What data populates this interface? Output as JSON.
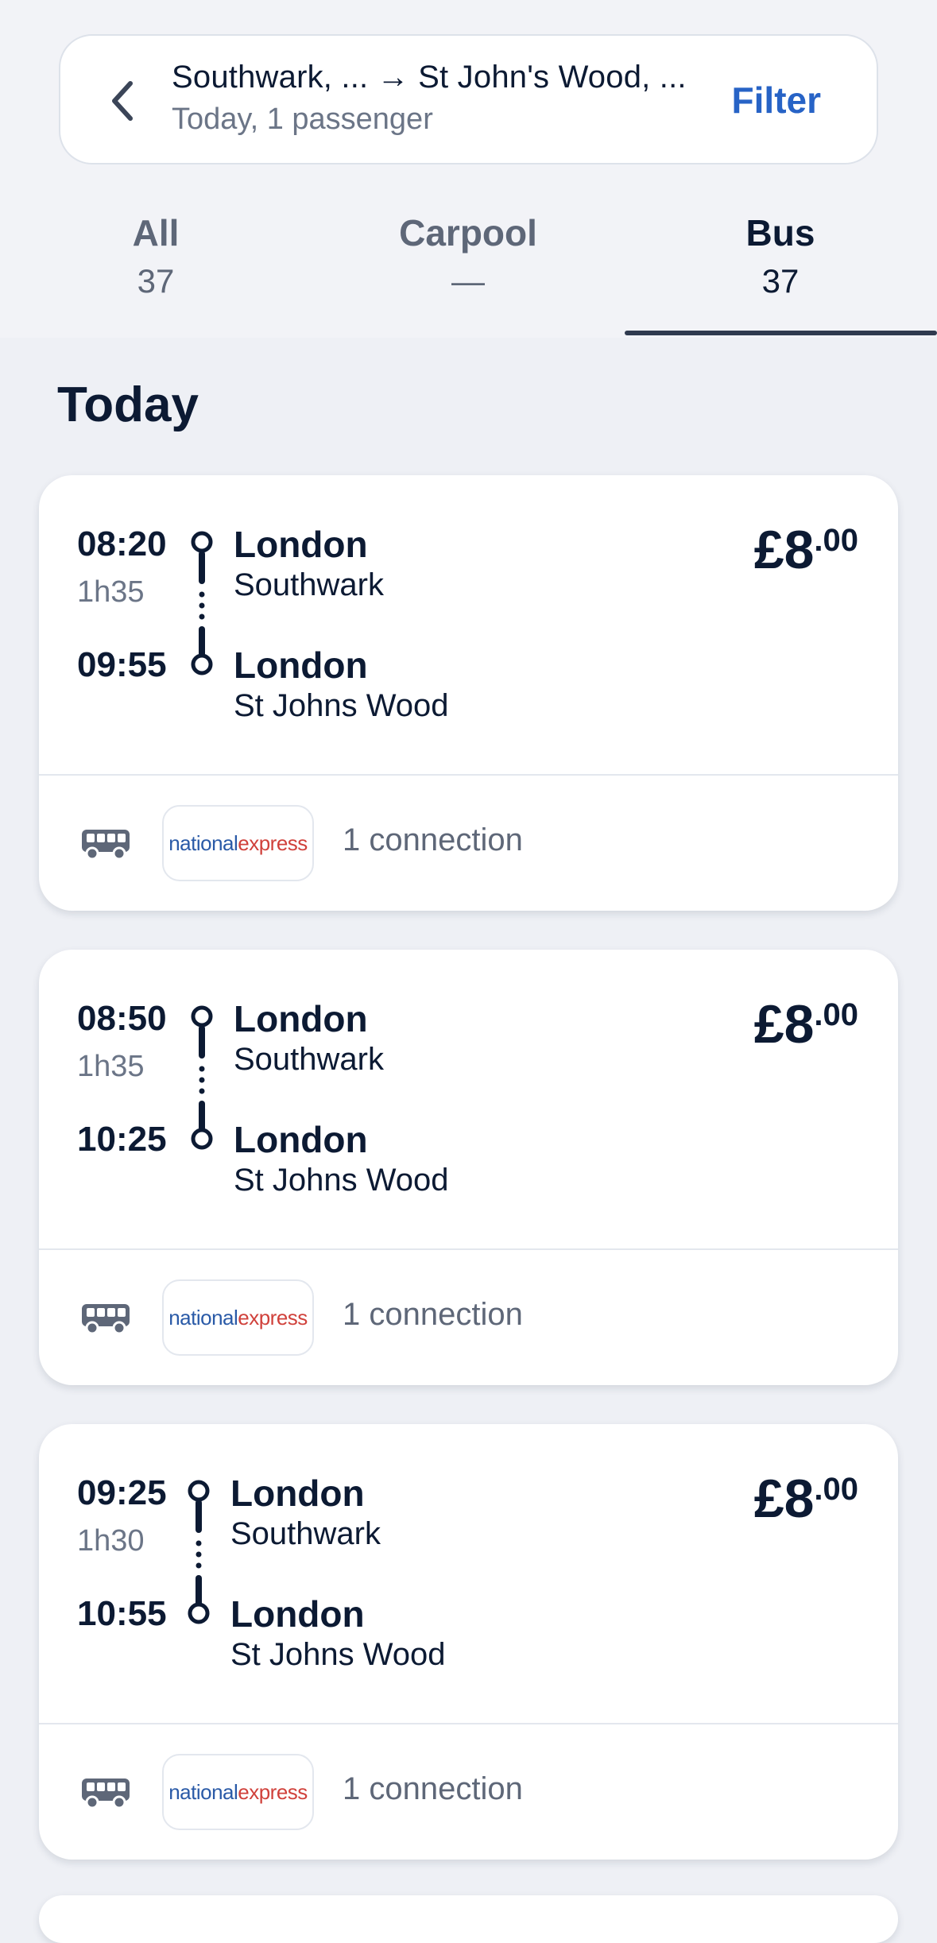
{
  "header": {
    "route": "Southwark, ... → St John's Wood, ...",
    "subtitle": "Today, 1 passenger",
    "filter_label": "Filter"
  },
  "tabs": [
    {
      "label": "All",
      "count": "37",
      "active": false
    },
    {
      "label": "Carpool",
      "count": "—",
      "active": false
    },
    {
      "label": "Bus",
      "count": "37",
      "active": true
    }
  ],
  "section": {
    "heading": "Today"
  },
  "results": [
    {
      "depart_time": "08:20",
      "duration": "1h35",
      "arrive_time": "09:55",
      "from_city": "London",
      "from_stop": "Southwark",
      "to_city": "London",
      "to_stop": "St Johns Wood",
      "price_main": "£8",
      "price_cents": ".00",
      "operator": {
        "part1": "national",
        "part2": "express"
      },
      "connection": "1 connection"
    },
    {
      "depart_time": "08:50",
      "duration": "1h35",
      "arrive_time": "10:25",
      "from_city": "London",
      "from_stop": "Southwark",
      "to_city": "London",
      "to_stop": "St Johns Wood",
      "price_main": "£8",
      "price_cents": ".00",
      "operator": {
        "part1": "national",
        "part2": "express"
      },
      "connection": "1 connection"
    },
    {
      "depart_time": "09:25",
      "duration": "1h30",
      "arrive_time": "10:55",
      "from_city": "London",
      "from_stop": "Southwark",
      "to_city": "London",
      "to_stop": "St Johns Wood",
      "price_main": "£8",
      "price_cents": ".00",
      "operator": {
        "part1": "national",
        "part2": "express"
      },
      "connection": "1 connection"
    }
  ],
  "colors": {
    "accent": "#2763c6",
    "text": "#0c1a33",
    "muted": "#6b7587"
  }
}
